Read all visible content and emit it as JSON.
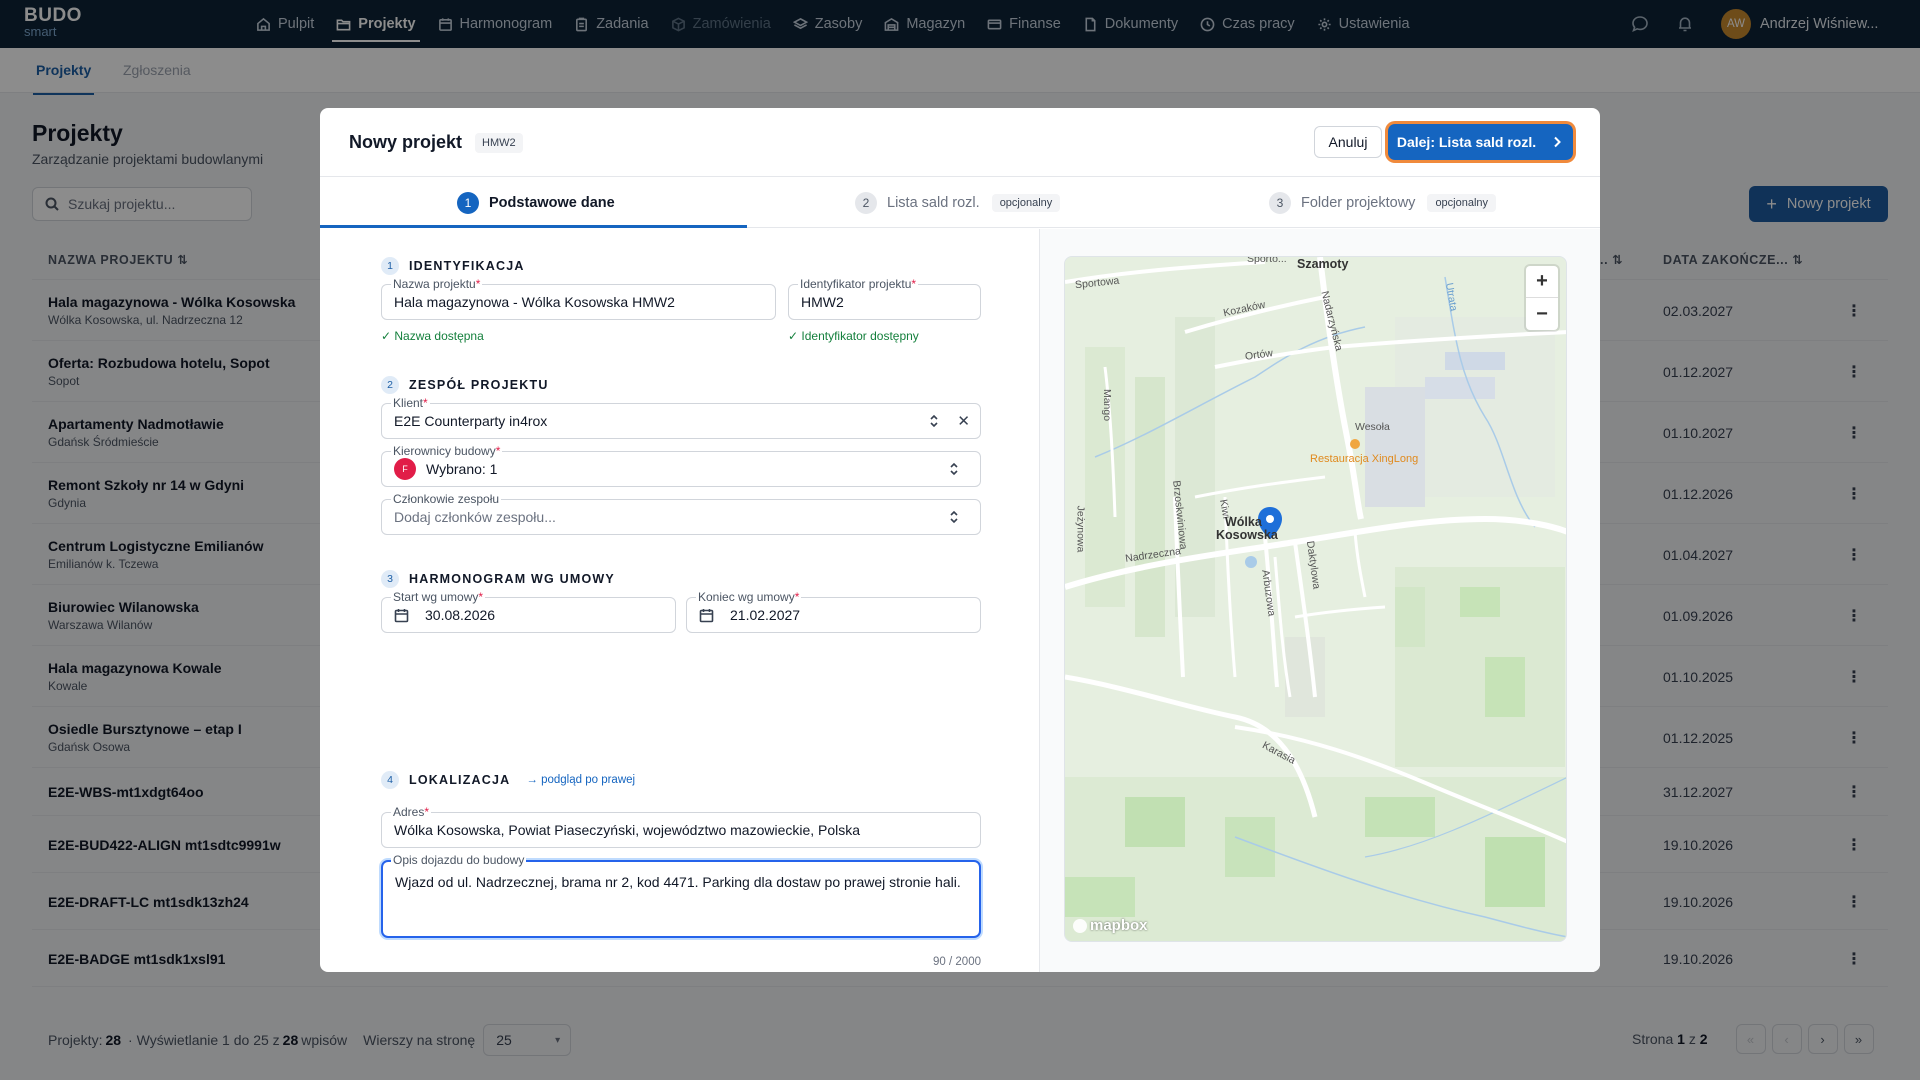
{
  "app": {
    "logo_top": "BUDO",
    "logo_bottom": "smart",
    "nav": [
      {
        "label": "Pulpit",
        "icon": "home-icon",
        "state": "normal"
      },
      {
        "label": "Projekty",
        "icon": "folder-icon",
        "state": "active"
      },
      {
        "label": "Harmonogram",
        "icon": "calendar-icon",
        "state": "normal"
      },
      {
        "label": "Zadania",
        "icon": "clipboard-icon",
        "state": "normal"
      },
      {
        "label": "Zamówienia",
        "icon": "cube-icon",
        "state": "disabled"
      },
      {
        "label": "Zasoby",
        "icon": "layers-icon",
        "state": "normal"
      },
      {
        "label": "Magazyn",
        "icon": "warehouse-icon",
        "state": "normal"
      },
      {
        "label": "Finanse",
        "icon": "card-icon",
        "state": "normal"
      },
      {
        "label": "Dokumenty",
        "icon": "document-icon",
        "state": "normal"
      },
      {
        "label": "Czas pracy",
        "icon": "clock-icon",
        "state": "normal"
      },
      {
        "label": "Ustawienia",
        "icon": "gear-icon",
        "state": "normal"
      }
    ],
    "user": {
      "initials": "AW",
      "name": "Andrzej Wiśniew..."
    }
  },
  "subtabs": {
    "projekty": "Projekty",
    "zgloszenia": "Zgłoszenia"
  },
  "page": {
    "title": "Projekty",
    "subtitle": "Zarządzanie projektami budowlanymi",
    "search_placeholder": "Szukaj projektu...",
    "new_button": "Nowy projekt",
    "col_name": "NAZWA PROJEKTU ⇅",
    "col_col2": "E... ⇅",
    "col_end": "DATA ZAKOŃCZE... ⇅",
    "rows": [
      {
        "name": "Hala magazynowa - Wólka Kosowska",
        "loc": "Wólka Kosowska, ul. Nadrzeczna 12",
        "end": "02.03.2027"
      },
      {
        "name": "Oferta: Rozbudowa hotelu, Sopot",
        "loc": "Sopot",
        "end": "01.12.2027"
      },
      {
        "name": "Apartamenty Nadmotławie",
        "loc": "Gdańsk Śródmieście",
        "end": "01.10.2027"
      },
      {
        "name": "Remont Szkoły nr 14 w Gdyni",
        "loc": "Gdynia",
        "end": "01.12.2026"
      },
      {
        "name": "Centrum Logistyczne Emilianów",
        "loc": "Emilianów k. Tczewa",
        "end": "01.04.2027"
      },
      {
        "name": "Biurowiec Wilanowska",
        "loc": "Warszawa Wilanów",
        "end": "01.09.2026"
      },
      {
        "name": "Hala magazynowa Kowale",
        "loc": "Kowale",
        "end": "01.10.2025"
      },
      {
        "name": "Osiedle Bursztynowe – etap I",
        "loc": "Gdańsk Osowa",
        "end": "01.12.2025"
      },
      {
        "name": "E2E-WBS-mt1xdgt64oo",
        "loc": "",
        "end": "31.12.2027"
      },
      {
        "name": "E2E-BUD422-ALIGN mt1sdtc9991w",
        "loc": "",
        "end": "19.10.2026"
      },
      {
        "name": "E2E-DRAFT-LC mt1sdk13zh24",
        "loc": "",
        "end": "19.10.2026"
      },
      {
        "name": "E2E-BADGE mt1sdk1xsl91",
        "loc": "",
        "end": "19.10.2026"
      }
    ],
    "footer": {
      "projects_label": "Projekty:",
      "projects_count": "28",
      "showing_prefix": "· Wyświetlanie 1 do 25 z",
      "showing_total": "28",
      "showing_suffix": "wpisów",
      "per_page_label": "Wierszy na stronę",
      "per_page_value": "25",
      "page_label": "Strona",
      "page_current": "1",
      "page_of": "z",
      "page_total": "2"
    }
  },
  "modal": {
    "title": "Nowy projekt",
    "badge": "HMW2",
    "cancel": "Anuluj",
    "next": "Dalej: Lista sald rozl.",
    "steps": [
      {
        "num": "1",
        "label": "Podstawowe dane",
        "optional": ""
      },
      {
        "num": "2",
        "label": "Lista sald rozl.",
        "optional": "opcjonalny"
      },
      {
        "num": "3",
        "label": "Folder projektowy",
        "optional": "opcjonalny"
      }
    ],
    "sections": {
      "s1": {
        "num": "1",
        "title": "IDENTYFIKACJA"
      },
      "s2": {
        "num": "2",
        "title": "ZESPÓŁ PROJEKTU"
      },
      "s3": {
        "num": "3",
        "title": "HARMONOGRAM WG UMOWY"
      },
      "s4": {
        "num": "4",
        "title": "LOKALIZACJA",
        "link": "→ podgląd po prawej"
      }
    },
    "fields": {
      "name": {
        "label": "Nazwa projektu",
        "value": "Hala magazynowa - Wólka Kosowska HMW2",
        "valid": "✓ Nazwa dostępna"
      },
      "ident": {
        "label": "Identyfikator projektu",
        "value": "HMW2",
        "valid": "✓ Identyfikator dostępny"
      },
      "client": {
        "label": "Klient",
        "value": "E2E Counterparty in4rox"
      },
      "managers": {
        "label": "Kierownicy budowy",
        "value": "Wybrano: 1",
        "badge": "F"
      },
      "members": {
        "label": "Członkowie zespołu",
        "placeholder": "Dodaj członków zespołu..."
      },
      "start": {
        "label": "Start wg umowy",
        "value": "30.08.2026"
      },
      "end": {
        "label": "Koniec wg umowy",
        "value": "21.02.2027"
      },
      "address": {
        "label": "Adres",
        "value": "Wólka Kosowska, Powiat Piaseczyński, województwo mazowieckie, Polska"
      },
      "directions": {
        "label": "Opis dojazdu do budowy",
        "value": "Wjazd od ul. Nadrzecznej, brama nr 2, kod 4471. Parking dla dostaw po prawej stronie hali.",
        "counter": "90 / 2000"
      }
    },
    "map": {
      "labels": {
        "szamoty": "Szamoty",
        "sportowa": "Sportowa",
        "sportowa2": "Sporto...",
        "kozakow": "Kozaków",
        "ortow": "Ortów",
        "nadarzynska": "Nadarzyńska",
        "mango": "Mango",
        "wesola": "Wesoła",
        "restaurant": "Restauracja XingLong",
        "brzoskwiniowa": "Brzoskwiniowa",
        "kiwi": "Kiwi",
        "wolka": "Wólka",
        "kosowska": "Kosowska",
        "jezynowa": "Jeżynowa",
        "nadrzeczna": "Nadrzeczna",
        "daktylowa": "Daktylowa",
        "arbuzowa": "Arbuzowa",
        "karasia": "Karasia",
        "utrata": "Utrata",
        "mapbox": "mapbox"
      },
      "zoom_in": "+",
      "zoom_out": "−",
      "pin_color": "#1e6fd9"
    }
  }
}
